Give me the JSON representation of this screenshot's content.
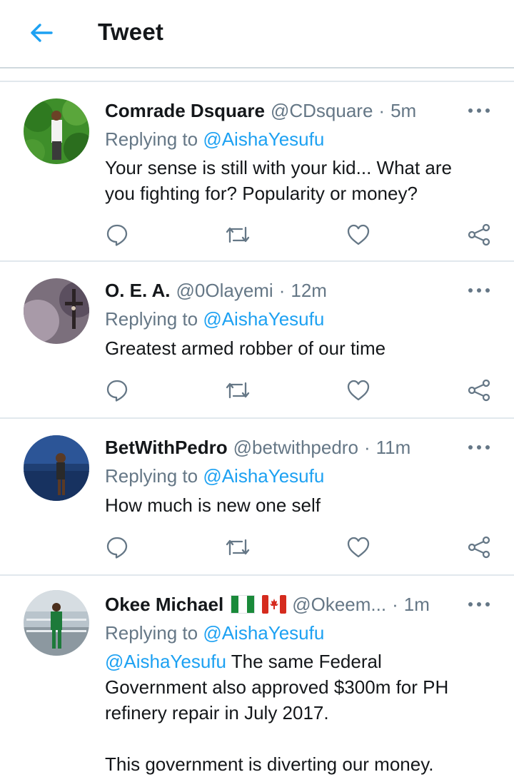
{
  "header": {
    "title": "Tweet",
    "back_icon": "arrow-left-icon"
  },
  "colors": {
    "accent": "#1da1f2",
    "secondary_text": "#657786",
    "divider": "#e1e8ed"
  },
  "tweets": [
    {
      "name": "Comrade Dsquare",
      "handle": "@CDsquare",
      "separator": "·",
      "time": "5m",
      "replying_prefix": "Replying to",
      "replying_to": "@AishaYesufu",
      "text": [
        "Your sense is still with your kid... What are",
        "you fighting for? Popularity or money?"
      ]
    },
    {
      "name": "O. E. A.",
      "handle": "@0Olayemi",
      "separator": "·",
      "time": "12m",
      "replying_prefix": "Replying to",
      "replying_to": "@AishaYesufu",
      "text": [
        "Greatest armed robber of our time"
      ]
    },
    {
      "name": "BetWithPedro",
      "handle": "@betwithpedro",
      "separator": "·",
      "time": "11m",
      "replying_prefix": "Replying to",
      "replying_to": "@AishaYesufu",
      "text": [
        "How much is new one self"
      ]
    },
    {
      "name": "Okee Michael",
      "flags": [
        "nigeria-flag",
        "canada-flag"
      ],
      "handle": "@Okeem...",
      "separator": "·",
      "time": "1m",
      "replying_prefix": "Replying to",
      "replying_to": "@AishaYesufu",
      "text_mention": "@AishaYesufu",
      "text_line1_rest": " The same Federal",
      "text": [
        "Government also approved $300m for PH",
        "refinery repair in July 2017.",
        "",
        "This government is diverting our money."
      ]
    }
  ]
}
